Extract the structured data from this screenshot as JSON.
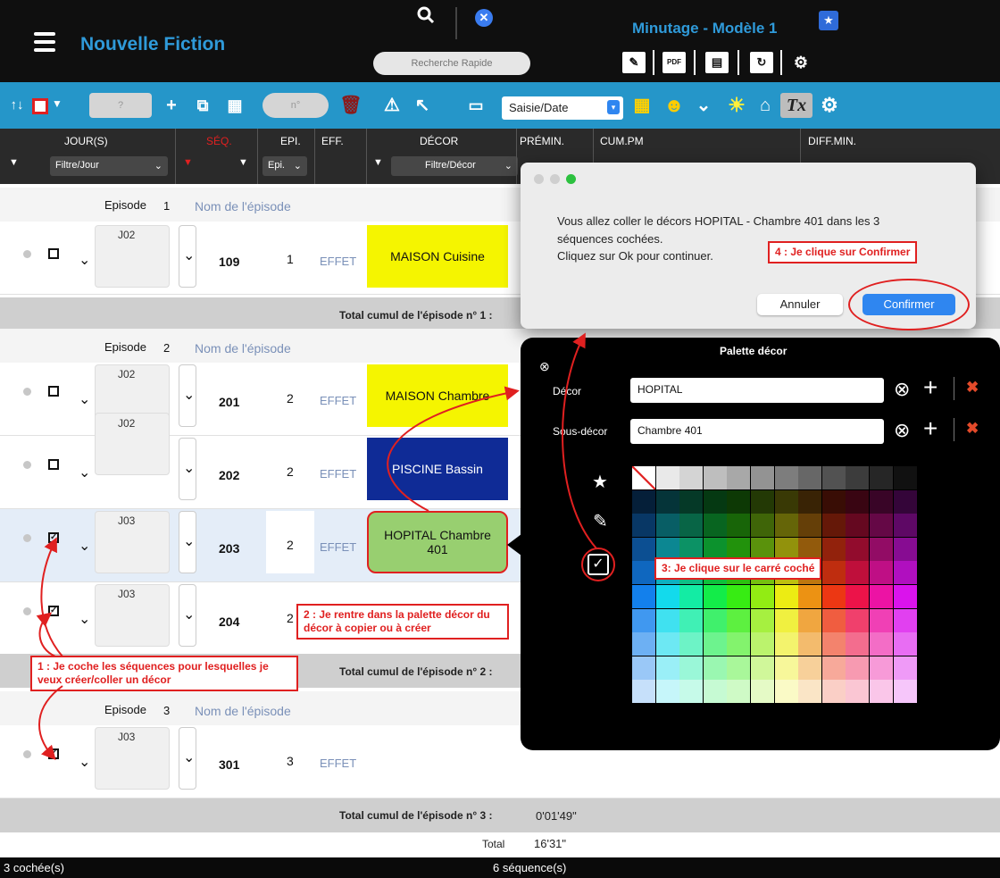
{
  "app": {
    "title": "Nouvelle Fiction",
    "model_title": "Minutage - Modèle 1",
    "search_placeholder": "Recherche Rapide",
    "pdf_label": "PDF"
  },
  "toolbar": {
    "box1": "?",
    "box2": "n°",
    "date_select": "Saisie/Date"
  },
  "columns": {
    "jours": "JOUR(S)",
    "jours_filter": "Filtre/Jour",
    "seq": "SÉQ.",
    "epi": "EPI.",
    "epi_filter": "Epi.",
    "eff": "EFF.",
    "decor": "DÉCOR",
    "decor_filter": "Filtre/Décor",
    "premin": "PRÉMIN.",
    "cumpm": "CUM.PM",
    "diffmin": "DIFF.MIN."
  },
  "episodes": [
    {
      "label": "Episode",
      "number": "1",
      "name_placeholder": "Nom de l'épisode",
      "total_label": "Total cumul de l'épisode n° 1 :"
    },
    {
      "label": "Episode",
      "number": "2",
      "name_placeholder": "Nom de l'épisode",
      "total_label": "Total cumul de l'épisode n° 2 :"
    },
    {
      "label": "Episode",
      "number": "3",
      "name_placeholder": "Nom de l'épisode",
      "total_label": "Total cumul de l'épisode n° 3 :",
      "total_value": "0'01'49\""
    }
  ],
  "rows": [
    {
      "day": "J02",
      "seq": "109",
      "epi": "1",
      "effet": "EFFET",
      "decor": "MAISON Cuisine",
      "decor_color": "#f5f500",
      "checked": false
    },
    {
      "day": "J02",
      "seq": "201",
      "epi": "2",
      "effet": "EFFET",
      "decor": "MAISON Chambre",
      "decor_color": "#f5f500",
      "checked": false
    },
    {
      "day": "J02",
      "seq": "202",
      "epi": "2",
      "effet": "EFFET",
      "decor": "PISCINE Bassin",
      "decor_color": "#0f2b96",
      "checked": false
    },
    {
      "day": "J03",
      "seq": "203",
      "epi": "2",
      "effet": "EFFET",
      "decor": "HOPITAL Chambre 401",
      "decor_color": "#98cf70",
      "checked": true
    },
    {
      "day": "J03",
      "seq": "204",
      "epi": "2",
      "effet": "EFFET",
      "decor": "",
      "decor_color": "#ffffff",
      "checked": true
    },
    {
      "day": "J03",
      "seq": "301",
      "epi": "3",
      "effet": "EFFET",
      "decor": "",
      "decor_color": "#ffffff",
      "checked": true
    }
  ],
  "grand_total": {
    "label": "Total",
    "value": "16'31\""
  },
  "status": {
    "checked": "3 cochée(s)",
    "sequences": "6 séquence(s)"
  },
  "dialog": {
    "message_line1": "Vous allez coller le décors HOPITAL - Chambre 401 dans les 3",
    "message_line2": "séquences cochées.",
    "message_line3": "Cliquez sur Ok pour continuer.",
    "cancel": "Annuler",
    "confirm": "Confirmer"
  },
  "palette": {
    "title": "Palette décor",
    "decor_label": "Décor",
    "decor_value": "HOPITAL",
    "subdecor_label": "Sous-décor",
    "subdecor_value": "Chambre 401"
  },
  "annotations": {
    "n1": "1 : Je coche les séquences pour lesquelles je veux créer/coller un décor",
    "n2": "2 : Je rentre dans la palette décor du décor à copier ou à créer",
    "n3": "3: Je clique sur le carré coché",
    "n4": "4 : Je clique sur Confirmer"
  },
  "colors": {
    "accent": "#2596c9",
    "annotation": "#e02020",
    "confirm": "#2f86f0"
  }
}
